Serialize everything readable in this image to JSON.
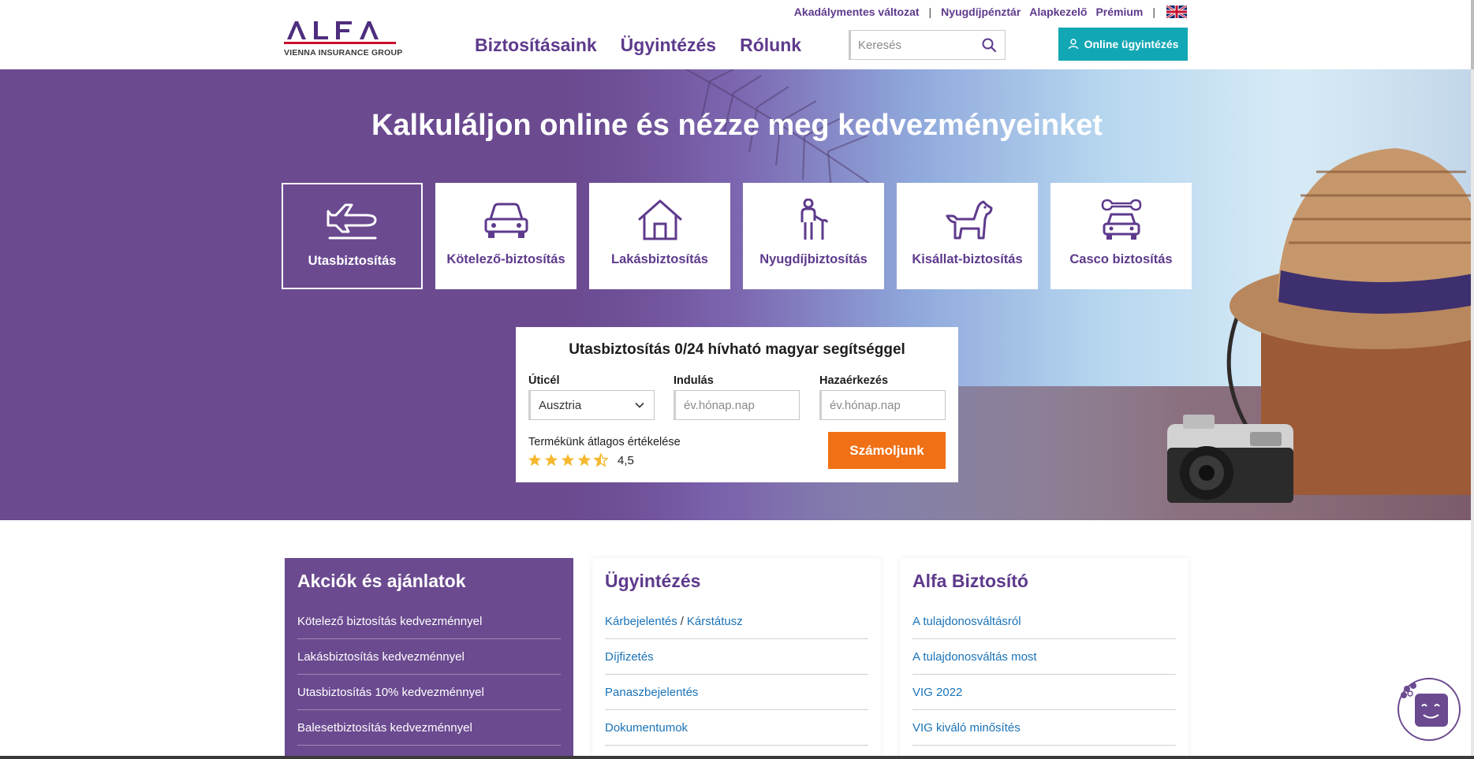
{
  "brand": {
    "logo_text": "ALFA",
    "logo_subtitle": "VIENNA INSURANCE GROUP"
  },
  "top_links": {
    "accessibility": "Akadálymentes változat",
    "pension_fund": "Nyugdíjpénztár",
    "fund_manager": "Alapkezelő",
    "premium": "Prémium",
    "language_flag": "uk-flag-icon"
  },
  "nav": {
    "insurances": "Biztosításaink",
    "services": "Ügyintézés",
    "about": "Rólunk"
  },
  "search": {
    "placeholder": "Keresés"
  },
  "online_button": {
    "label": "Online ügyintézés",
    "color": "#12a7b4"
  },
  "hero": {
    "title": "Kalkuláljon online és nézze meg kedvezményeinket",
    "background_color": "#6b4a90"
  },
  "products": [
    {
      "label": "Utasbiztosítás",
      "icon": "airplane-icon",
      "active": true
    },
    {
      "label": "Kötelező-biztosítás",
      "icon": "car-icon",
      "active": false
    },
    {
      "label": "Lakásbiztosítás",
      "icon": "house-icon",
      "active": false
    },
    {
      "label": "Nyugdíjbiztosítás",
      "icon": "elderly-person-icon",
      "active": false
    },
    {
      "label": "Kisállat-biztosítás",
      "icon": "dog-icon",
      "active": false
    },
    {
      "label": "Casco biztosítás",
      "icon": "car-wrench-icon",
      "active": false
    }
  ],
  "calculator": {
    "title": "Utasbiztosítás 0/24 hívható magyar segítséggel",
    "destination_label": "Úticél",
    "destination_value": "Ausztria",
    "departure_label": "Indulás",
    "departure_placeholder": "év.hónap.nap",
    "return_label": "Hazaérkezés",
    "return_placeholder": "év.hónap.nap",
    "rating_label": "Termékünk átlagos értékelése",
    "rating_value": "4,5",
    "rating_stars": 4.5,
    "submit_label": "Számoljunk",
    "submit_color": "#f07015"
  },
  "panels": {
    "promo": {
      "title": "Akciók és ajánlatok",
      "items": [
        "Kötelező biztosítás kedvezménnyel",
        "Lakásbiztosítás kedvezménnyel",
        "Utasbiztosítás 10% kedvezménnyel",
        "Balesetbiztosítás kedvezménnyel"
      ]
    },
    "service": {
      "title": "Ügyintézés",
      "claim": "Kárbejelentés",
      "slash": "/",
      "claim_status": "Kárstátusz",
      "items": [
        "Díjfizetés",
        "Panaszbejelentés",
        "Dokumentumok"
      ]
    },
    "about": {
      "title": "Alfa Biztosító",
      "items": [
        "A tulajdonosváltásról",
        "A tulajdonosváltás most",
        "VIG 2022",
        "VIG kiváló minősítés"
      ]
    }
  },
  "chatbot": {
    "icon": "chatbot-face-icon"
  },
  "colors": {
    "brand_purple": "#5e3a8c",
    "panel_purple": "#6b4a90",
    "link_blue": "#1a73b8"
  }
}
